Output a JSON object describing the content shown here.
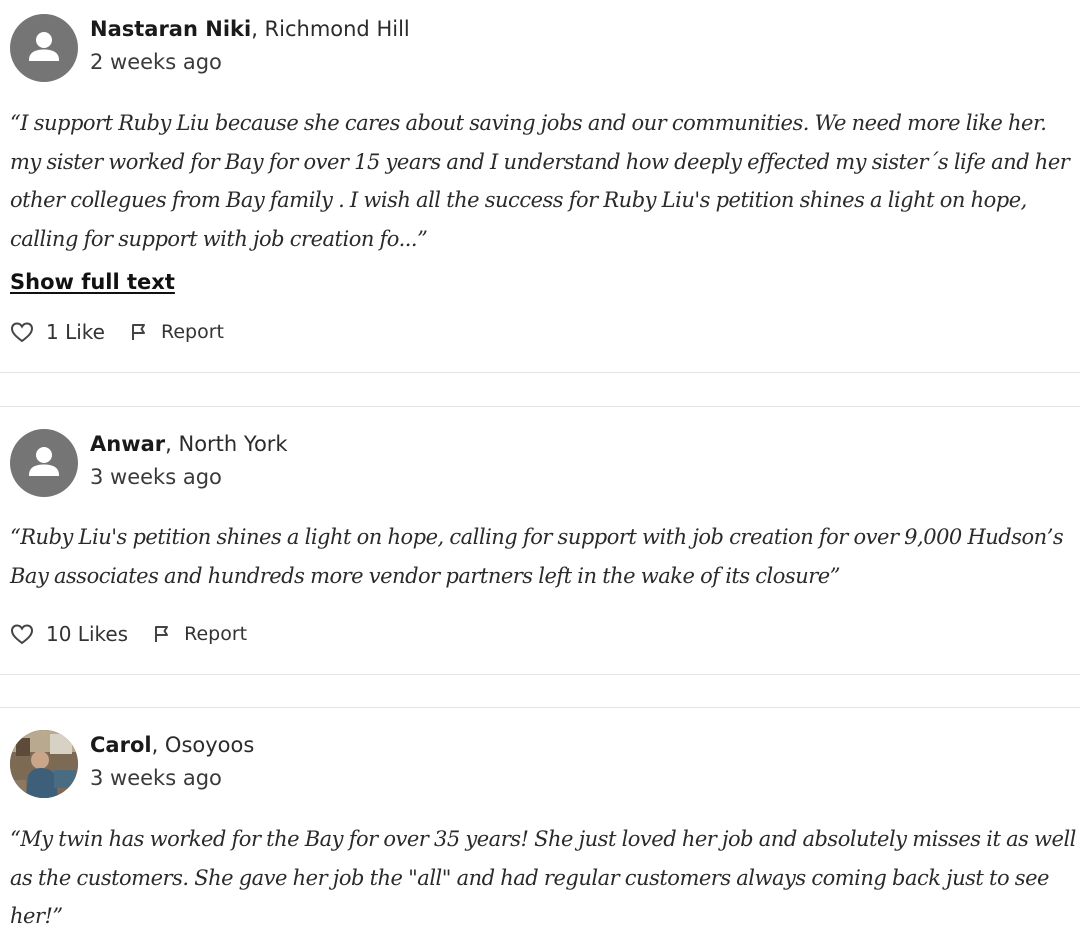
{
  "comments": [
    {
      "author": "Nastaran Niki",
      "location": ", Richmond Hill",
      "time": "2 weeks ago",
      "avatar_icon": "person-icon",
      "text": "“I support Ruby Liu because she cares about saving jobs and our communities. We need more like her. my sister worked for Bay for over 15 years and I understand how deeply effected my sister´s life and her other collegues from Bay family . I wish all the success for Ruby Liu's petition shines a light on hope, calling for support with job creation fo...”",
      "show_full": "Show full text",
      "likes": "1 Like",
      "report": "Report"
    },
    {
      "author": "Anwar",
      "location": ", North York",
      "time": "3 weeks ago",
      "avatar_icon": "person-icon",
      "text": "“Ruby Liu's petition shines a light on hope, calling for support with job creation for over 9,000 Hudson’s Bay associates and hundreds more vendor partners left in the wake of its closure”",
      "likes": "10 Likes",
      "report": "Report"
    },
    {
      "author": "Carol",
      "location": ", Osoyoos",
      "time": "3 weeks ago",
      "avatar_icon": "user-photo",
      "text": "“My twin has worked for the Bay for over 35 years! She just loved her job and absolutely misses it as well as the customers. She gave her job the \"all\" and had regular customers always coming back just to see her!”"
    }
  ],
  "colors": {
    "avatar_bg": "#757575",
    "divider": "#e4e4e4",
    "text": "#2a2a2a"
  }
}
